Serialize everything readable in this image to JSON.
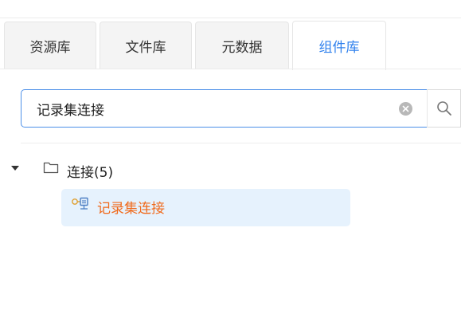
{
  "tabs": [
    {
      "label": "资源库",
      "active": false
    },
    {
      "label": "文件库",
      "active": false
    },
    {
      "label": "元数据",
      "active": false
    },
    {
      "label": "组件库",
      "active": true
    }
  ],
  "search": {
    "value": "记录集连接",
    "clear_icon": "clear-circle-icon",
    "search_icon": "magnifier-icon"
  },
  "tree": {
    "folder": {
      "label": "连接(5)",
      "expanded": true,
      "icon": "folder-icon",
      "children": [
        {
          "label": "记录集连接",
          "icon": "recordset-connection-icon",
          "selected": true
        }
      ]
    }
  },
  "colors": {
    "accent": "#2f80ed",
    "search_border": "#4d90e8",
    "selected_bg": "#e6f2fd",
    "highlight_text": "#f06a1c"
  }
}
